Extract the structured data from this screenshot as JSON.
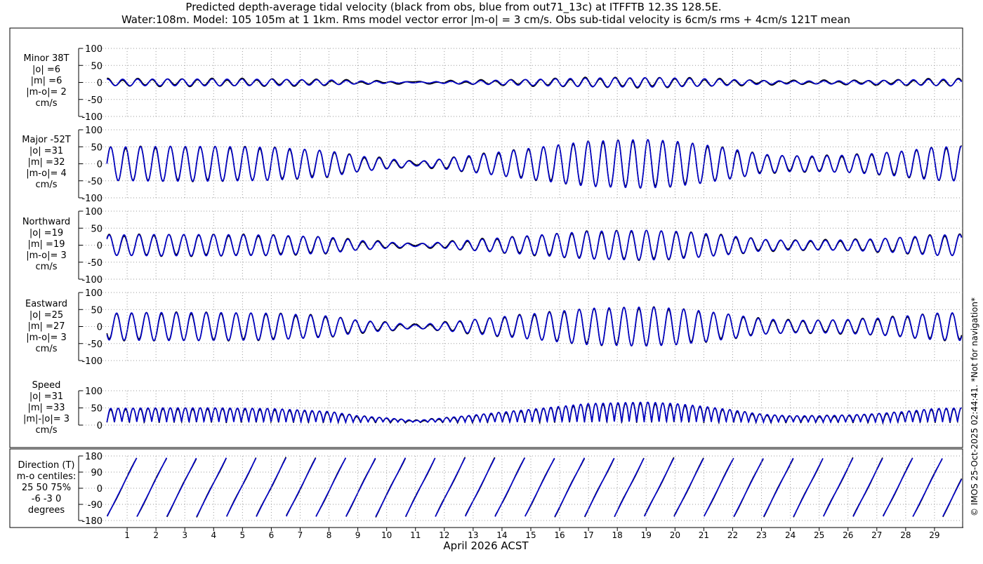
{
  "title_line1": "Predicted depth-average tidal velocity (black from obs, blue from out71_13c) at ITFFTB 12.3S 128.5E.",
  "title_line2": "Water:108m. Model: 105 105m at 1 1km. Rms model vector error |m-o| = 3 cm/s. Obs sub-tidal velocity is 6cm/s rms + 4cm/s 121T mean",
  "xlabel": "April 2026 ACST",
  "side_note": "© IMOS 25-Oct-2025 02:44:41. *Not for navigation*",
  "colors": {
    "obs": "#000000",
    "model": "#0000cc",
    "grid": "#9a9a9a"
  },
  "chart_data": {
    "type": "line",
    "x_ticks": [
      "1",
      "2",
      "3",
      "4",
      "5",
      "6",
      "7",
      "8",
      "9",
      "10",
      "11",
      "12",
      "13",
      "14",
      "15",
      "16",
      "17",
      "18",
      "19",
      "20",
      "21",
      "22",
      "23",
      "24",
      "25",
      "26",
      "27",
      "28",
      "29"
    ],
    "xlim_days": [
      0.0,
      30.0
    ],
    "series_legend": [
      "obs (black)",
      "model (blue)"
    ],
    "grid": true,
    "panels": [
      {
        "key": "minor",
        "label": [
          "Minor 38T",
          "|o| =6",
          "|m| =6",
          "|m-o|= 2",
          "cm/s"
        ],
        "ylim": [
          -100,
          100
        ],
        "yticks": [
          "100",
          "50",
          "0",
          "-50",
          "-100"
        ],
        "amplitude": 6
      },
      {
        "key": "major",
        "label": [
          "Major -52T",
          "|o| =31",
          "|m| =32",
          "|m-o|= 4",
          "cm/s"
        ],
        "ylim": [
          -100,
          100
        ],
        "yticks": [
          "100",
          "50",
          "0",
          "-50",
          "-100"
        ],
        "amplitude": 31
      },
      {
        "key": "north",
        "label": [
          "Northward",
          "|o| =19",
          "|m| =19",
          "|m-o|= 3",
          "cm/s"
        ],
        "ylim": [
          -100,
          100
        ],
        "yticks": [
          "100",
          "50",
          "0",
          "-50",
          "-100"
        ],
        "amplitude": 19
      },
      {
        "key": "east",
        "label": [
          "Eastward",
          "|o| =25",
          "|m| =27",
          "|m-o|= 3",
          "cm/s"
        ],
        "ylim": [
          -100,
          100
        ],
        "yticks": [
          "100",
          "50",
          "0",
          "-50",
          "-100"
        ],
        "amplitude": 25
      },
      {
        "key": "speed",
        "label": [
          "Speed",
          "|o| =31",
          "|m| =33",
          "|m|-|o|= 3",
          "cm/s"
        ],
        "ylim": [
          0,
          100
        ],
        "yticks": [
          "100",
          "50",
          "0"
        ],
        "amplitude": 31
      },
      {
        "key": "dir",
        "label": [
          "Direction (T)",
          "m-o centiles:",
          "25  50  75%",
          "-6 -3  0",
          "degrees"
        ],
        "ylim": [
          -180,
          180
        ],
        "yticks": [
          "180",
          "90",
          "0",
          "-90",
          "-180"
        ],
        "amplitude": 180
      }
    ],
    "tidal_envelope": {
      "day": [
        0,
        2,
        4,
        6,
        8,
        9,
        10,
        11,
        12,
        13,
        14,
        15,
        16,
        17,
        18,
        19,
        20,
        21,
        22,
        23,
        24,
        25,
        26,
        27,
        28,
        29,
        30
      ],
      "relative_amplitude": [
        0.95,
        1.0,
        1.0,
        0.95,
        0.75,
        0.45,
        0.3,
        0.12,
        0.3,
        0.5,
        0.7,
        0.9,
        1.1,
        1.3,
        1.35,
        1.4,
        1.3,
        1.1,
        0.85,
        0.55,
        0.45,
        0.45,
        0.5,
        0.6,
        0.75,
        0.95,
        1.0
      ]
    }
  }
}
